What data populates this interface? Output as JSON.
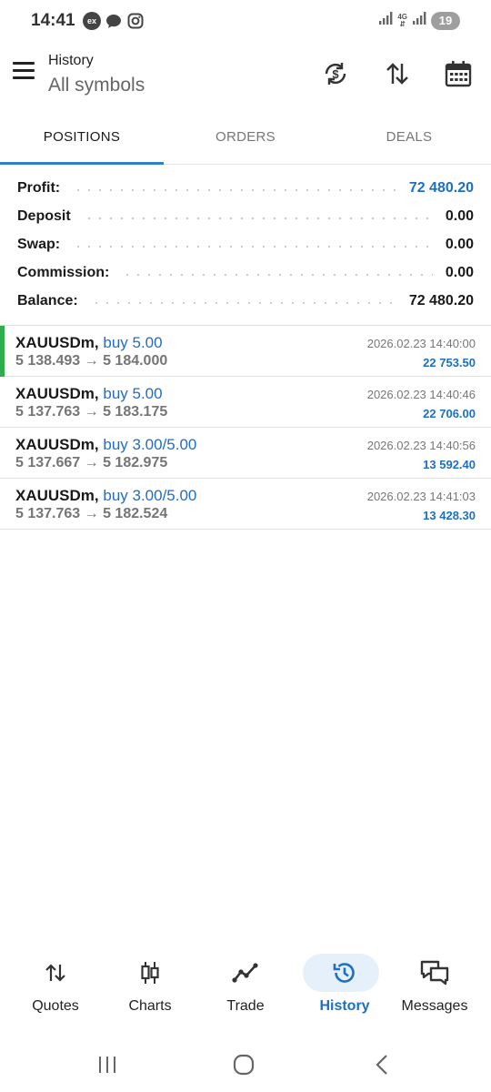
{
  "status_bar": {
    "time": "14:41",
    "notif_ex": "ex",
    "network": "4G",
    "battery": "19"
  },
  "header": {
    "title": "History",
    "subtitle": "All symbols",
    "icons": [
      "currency-exchange-icon",
      "sort-icon",
      "calendar-icon"
    ]
  },
  "tabs": [
    {
      "label": "POSITIONS",
      "active": true
    },
    {
      "label": "ORDERS",
      "active": false
    },
    {
      "label": "DEALS",
      "active": false
    }
  ],
  "summary": {
    "profit": {
      "label": "Profit:",
      "value": "72 480.20"
    },
    "deposit": {
      "label": "Deposit",
      "value": "0.00"
    },
    "swap": {
      "label": "Swap:",
      "value": "0.00"
    },
    "commission": {
      "label": "Commission:",
      "value": "0.00"
    },
    "balance": {
      "label": "Balance:",
      "value": "72 480.20"
    }
  },
  "deals": [
    {
      "symbol": "XAUUSDm,",
      "type": "buy 5.00",
      "prices": "5 138.493 → 5 184.000",
      "time": "2026.02.23 14:40:00",
      "profit": "22 753.50"
    },
    {
      "symbol": "XAUUSDm,",
      "type": "buy 5.00",
      "prices": "5 137.763 → 5 183.175",
      "time": "2026.02.23 14:40:46",
      "profit": "22 706.00"
    },
    {
      "symbol": "XAUUSDm,",
      "type": "buy 3.00/5.00",
      "prices": "5 137.667 → 5 182.975",
      "time": "2026.02.23 14:40:56",
      "profit": "13 592.40"
    },
    {
      "symbol": "XAUUSDm,",
      "type": "buy 3.00/5.00",
      "prices": "5 137.763 → 5 182.524",
      "time": "2026.02.23 14:41:03",
      "profit": "13 428.30"
    }
  ],
  "bottom_nav": [
    {
      "label": "Quotes",
      "icon": "quotes-icon",
      "active": false
    },
    {
      "label": "Charts",
      "icon": "candlestick-icon",
      "active": false
    },
    {
      "label": "Trade",
      "icon": "trade-line-icon",
      "active": false
    },
    {
      "label": "History",
      "icon": "history-icon",
      "active": true
    },
    {
      "label": "Messages",
      "icon": "messages-icon",
      "active": false
    }
  ],
  "colors": {
    "accent": "#1d6fc4",
    "tab_indicator": "#2f7fd0",
    "selected_marker": "#2fae4b",
    "nav_active_bg": "#e6f0fb"
  }
}
